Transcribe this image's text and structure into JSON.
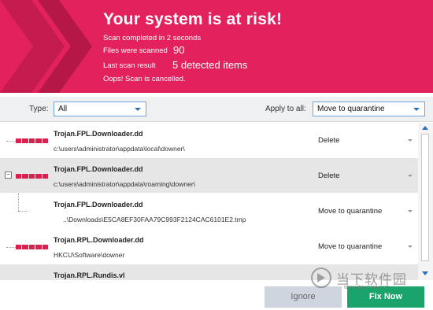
{
  "header": {
    "title": "Your system is at risk!",
    "scan_completed": "Scan completed in 2 seconds",
    "files_scanned_label": "Files were scanned",
    "files_scanned_value": "90",
    "last_result_label": "Last scan result",
    "last_result_value": "5 detected items",
    "cancel_message": "Oops! Scan is cancelled.",
    "accent_color": "#e2215d"
  },
  "filter": {
    "type_label": "Type:",
    "type_value": "All",
    "apply_label": "Apply to all:",
    "apply_value": "Move to quarantine"
  },
  "items": [
    {
      "name": "Trojan.FPL.Downloader.dd",
      "path": "c:\\users\\administrator\\appdata\\local\\downer\\",
      "action": "Delete"
    },
    {
      "name": "Trojan.FPL.Downloader.dd",
      "path": "c:\\users\\administrator\\appdata\\roaming\\downer\\",
      "action": "Delete",
      "expander": "−"
    },
    {
      "name": "Trojan.FPL.Downloader.dd",
      "path": "..\\Downloads\\E5CA8EF30FAA79C993F2124CAC6101E2.tmp",
      "action": "Move to quarantine"
    },
    {
      "name": "Trojan.RPL.Downloader.dd",
      "path": "HKCU\\Software\\downer",
      "action": "Move to quarantine"
    },
    {
      "name": "Trojan.RPL.Rundis.vl",
      "path": "",
      "action": ""
    }
  ],
  "footer": {
    "ignore_label": "Ignore",
    "fix_label": "Fix Now"
  },
  "watermark": {
    "text": "当下软件园",
    "sub": "www.downxia.com"
  }
}
